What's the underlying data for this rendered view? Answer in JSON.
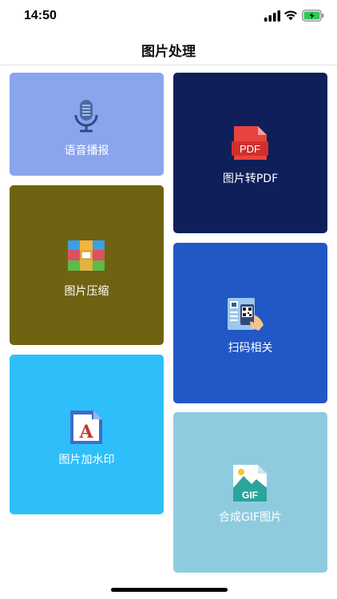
{
  "status_bar": {
    "time": "14:50"
  },
  "nav": {
    "title": "图片处理"
  },
  "tiles": [
    {
      "label": "语音播报",
      "color": "#8aa5ee",
      "icon": "microphone-icon"
    },
    {
      "label": "图片压缩",
      "color": "#6f6312",
      "icon": "archive-icon"
    },
    {
      "label": "图片加水印",
      "color": "#2ebffa",
      "icon": "document-a-icon"
    },
    {
      "label": "图片转PDF",
      "color": "#0f1f5a",
      "icon": "pdf-icon"
    },
    {
      "label": "扫码相关",
      "color": "#2257c6",
      "icon": "qr-scan-icon"
    },
    {
      "label": "合成GIF图片",
      "color": "#8fcbdf",
      "icon": "gif-image-icon"
    }
  ],
  "icons": {
    "pdf_text": "PDF",
    "gif_text": "GIF",
    "doc_letter": "A"
  }
}
